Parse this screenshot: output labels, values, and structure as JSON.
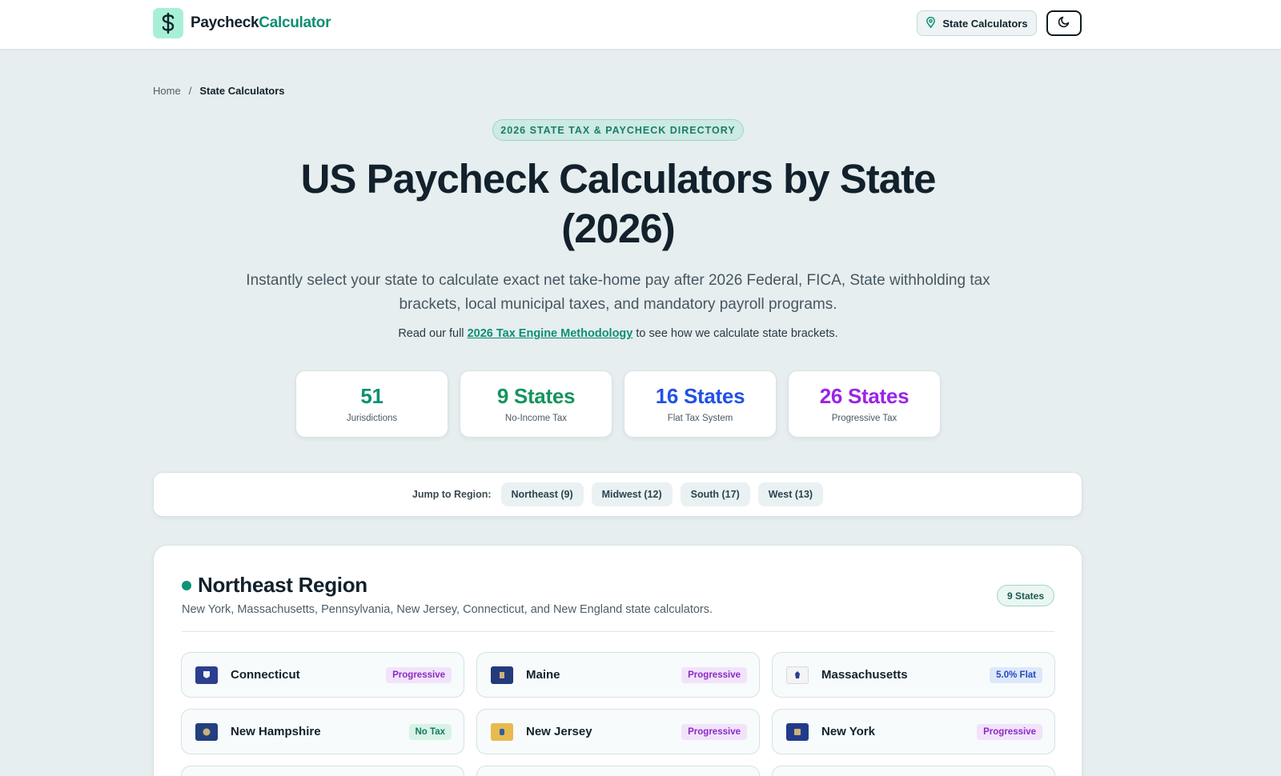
{
  "header": {
    "logo_part1": "Paycheck",
    "logo_part2": "Calculator",
    "nav_button": "State Calculators",
    "icons": {
      "logo": "dollar-icon",
      "nav": "map-pin-icon",
      "theme": "moon-icon"
    }
  },
  "breadcrumb": {
    "home": "Home",
    "separator": "/",
    "current": "State Calculators"
  },
  "hero": {
    "eyebrow": "2026 STATE TAX & PAYCHECK DIRECTORY",
    "title_line1": "US Paycheck Calculators by State",
    "title_line2": "(2026)",
    "subtitle": "Instantly select your state to calculate exact net take-home pay after 2026 Federal, FICA, State withholding tax brackets, local municipal taxes, and mandatory payroll programs.",
    "method_prefix": "Read our full ",
    "method_link": "2026 Tax Engine Methodology",
    "method_suffix": " to see how we calculate state brackets."
  },
  "stats": [
    {
      "value": "51",
      "label": "Jurisdictions",
      "color": "#0d8f73"
    },
    {
      "value": "9 States",
      "label": "No-Income Tax",
      "color": "#15945d"
    },
    {
      "value": "16 States",
      "label": "Flat Tax System",
      "color": "#2251e6"
    },
    {
      "value": "26 States",
      "label": "Progressive Tax",
      "color": "#9a24e8"
    }
  ],
  "jump": {
    "label": "Jump to Region:",
    "regions": [
      "Northeast (9)",
      "Midwest (12)",
      "South (17)",
      "West (13)"
    ]
  },
  "region": {
    "title": "Northeast Region",
    "description": "New York, Massachusetts, Pennsylvania, New Jersey, Connecticut, and New England state calculators.",
    "count": "9 States",
    "states": [
      {
        "name": "Connecticut",
        "tag": "Progressive",
        "kind": "progressive",
        "flag": "#2a3f8f"
      },
      {
        "name": "Maine",
        "tag": "Progressive",
        "kind": "progressive",
        "flag": "#233a7c"
      },
      {
        "name": "Massachusetts",
        "tag": "5.0% Flat",
        "kind": "flat",
        "flag": "#f4f4f4"
      },
      {
        "name": "New Hampshire",
        "tag": "No Tax",
        "kind": "notax",
        "flag": "#23407e"
      },
      {
        "name": "New Jersey",
        "tag": "Progressive",
        "kind": "progressive",
        "flag": "#e8b94f"
      },
      {
        "name": "New York",
        "tag": "Progressive",
        "kind": "progressive",
        "flag": "#223a8a"
      }
    ]
  }
}
